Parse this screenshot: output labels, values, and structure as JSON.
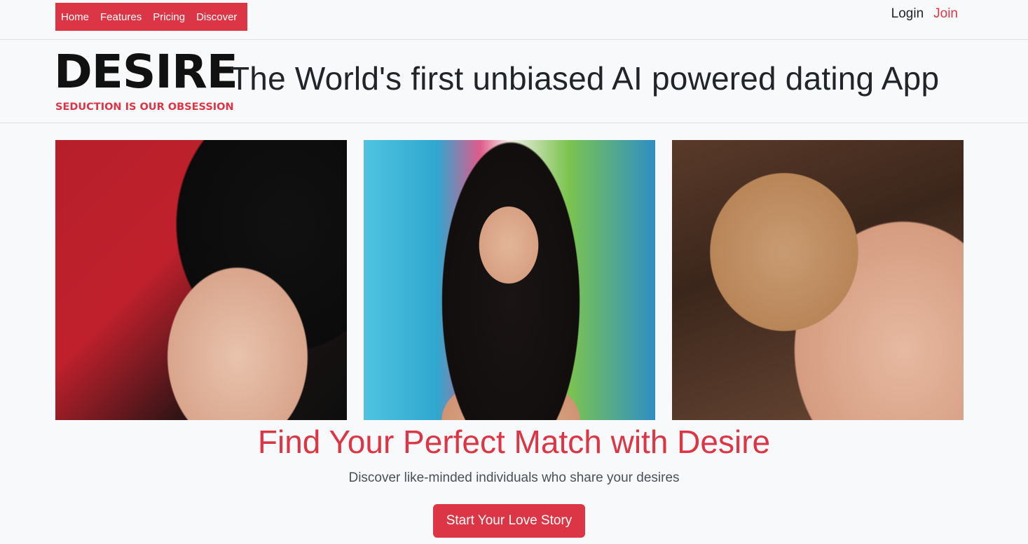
{
  "nav": {
    "links": [
      "Home",
      "Features",
      "Pricing",
      "Discover"
    ],
    "accent": "#dc3545"
  },
  "auth": {
    "login": "Login",
    "join": "Join"
  },
  "brand": {
    "name": "DESIRE",
    "slogan": "SEDUCTION IS OUR OBSESSION",
    "tagline": "The World's first unbiased AI powered dating App"
  },
  "gallery": [
    {
      "icon": "portrait-photo"
    },
    {
      "icon": "portrait-photo"
    },
    {
      "icon": "portrait-photo"
    }
  ],
  "hero": {
    "headline": "Find Your Perfect Match with Desire",
    "subline": "Discover like-minded individuals who share your desires",
    "cta": "Start Your Love Story"
  }
}
